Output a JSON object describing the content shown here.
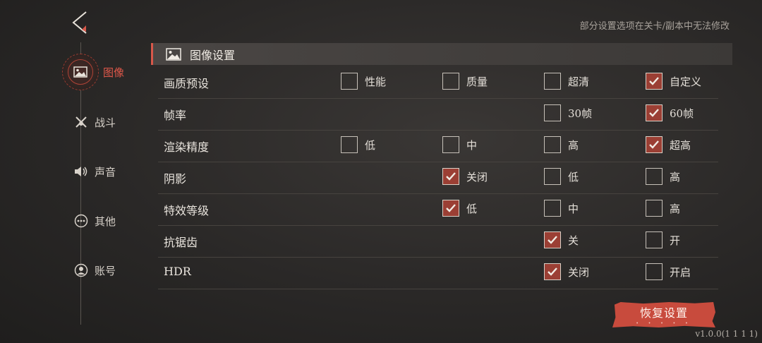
{
  "notice": "部分设置选项在关卡/副本中无法修改",
  "nav": {
    "active_label": "图像",
    "items": [
      {
        "label": "战斗",
        "icon": "crossed-swords-icon"
      },
      {
        "label": "声音",
        "icon": "speaker-icon"
      },
      {
        "label": "其他",
        "icon": "more-dots-icon"
      },
      {
        "label": "账号",
        "icon": "user-icon"
      }
    ]
  },
  "section": {
    "title": "图像设置",
    "icon": "image-icon"
  },
  "settings": [
    {
      "name": "画质预设",
      "options": [
        {
          "label": "性能",
          "checked": false
        },
        {
          "label": "质量",
          "checked": false
        },
        {
          "label": "超清",
          "checked": false
        },
        {
          "label": "自定义",
          "checked": true
        }
      ]
    },
    {
      "name": "帧率",
      "options": [
        {
          "label": "30帧",
          "checked": false
        },
        {
          "label": "60帧",
          "checked": true
        }
      ]
    },
    {
      "name": "渲染精度",
      "options": [
        {
          "label": "低",
          "checked": false
        },
        {
          "label": "中",
          "checked": false
        },
        {
          "label": "高",
          "checked": false
        },
        {
          "label": "超高",
          "checked": true
        }
      ]
    },
    {
      "name": "阴影",
      "options": [
        {
          "label": "关闭",
          "checked": true
        },
        {
          "label": "低",
          "checked": false
        },
        {
          "label": "高",
          "checked": false
        }
      ]
    },
    {
      "name": "特效等级",
      "options": [
        {
          "label": "低",
          "checked": true
        },
        {
          "label": "中",
          "checked": false
        },
        {
          "label": "高",
          "checked": false
        }
      ]
    },
    {
      "name": "抗锯齿",
      "options": [
        {
          "label": "关",
          "checked": true
        },
        {
          "label": "开",
          "checked": false
        }
      ]
    },
    {
      "name": "HDR",
      "options": [
        {
          "label": "关闭",
          "checked": true
        },
        {
          "label": "开启",
          "checked": false
        }
      ]
    }
  ],
  "restore_button": "恢复设置",
  "version": "v1.0.0(1 1 1 1)",
  "colors": {
    "accent": "#d8584a",
    "checked_fill": "#9b3f34",
    "button": "#c84b3d"
  }
}
